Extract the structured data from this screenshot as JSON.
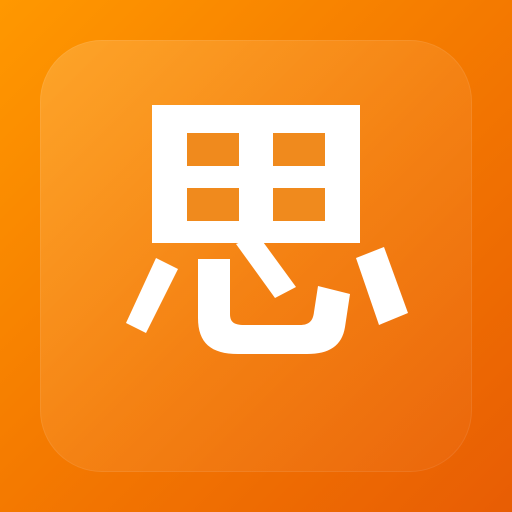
{
  "app_icon": {
    "glyph": "思",
    "background_color": "#F57C00",
    "foreground_color": "#FFFFFF"
  }
}
